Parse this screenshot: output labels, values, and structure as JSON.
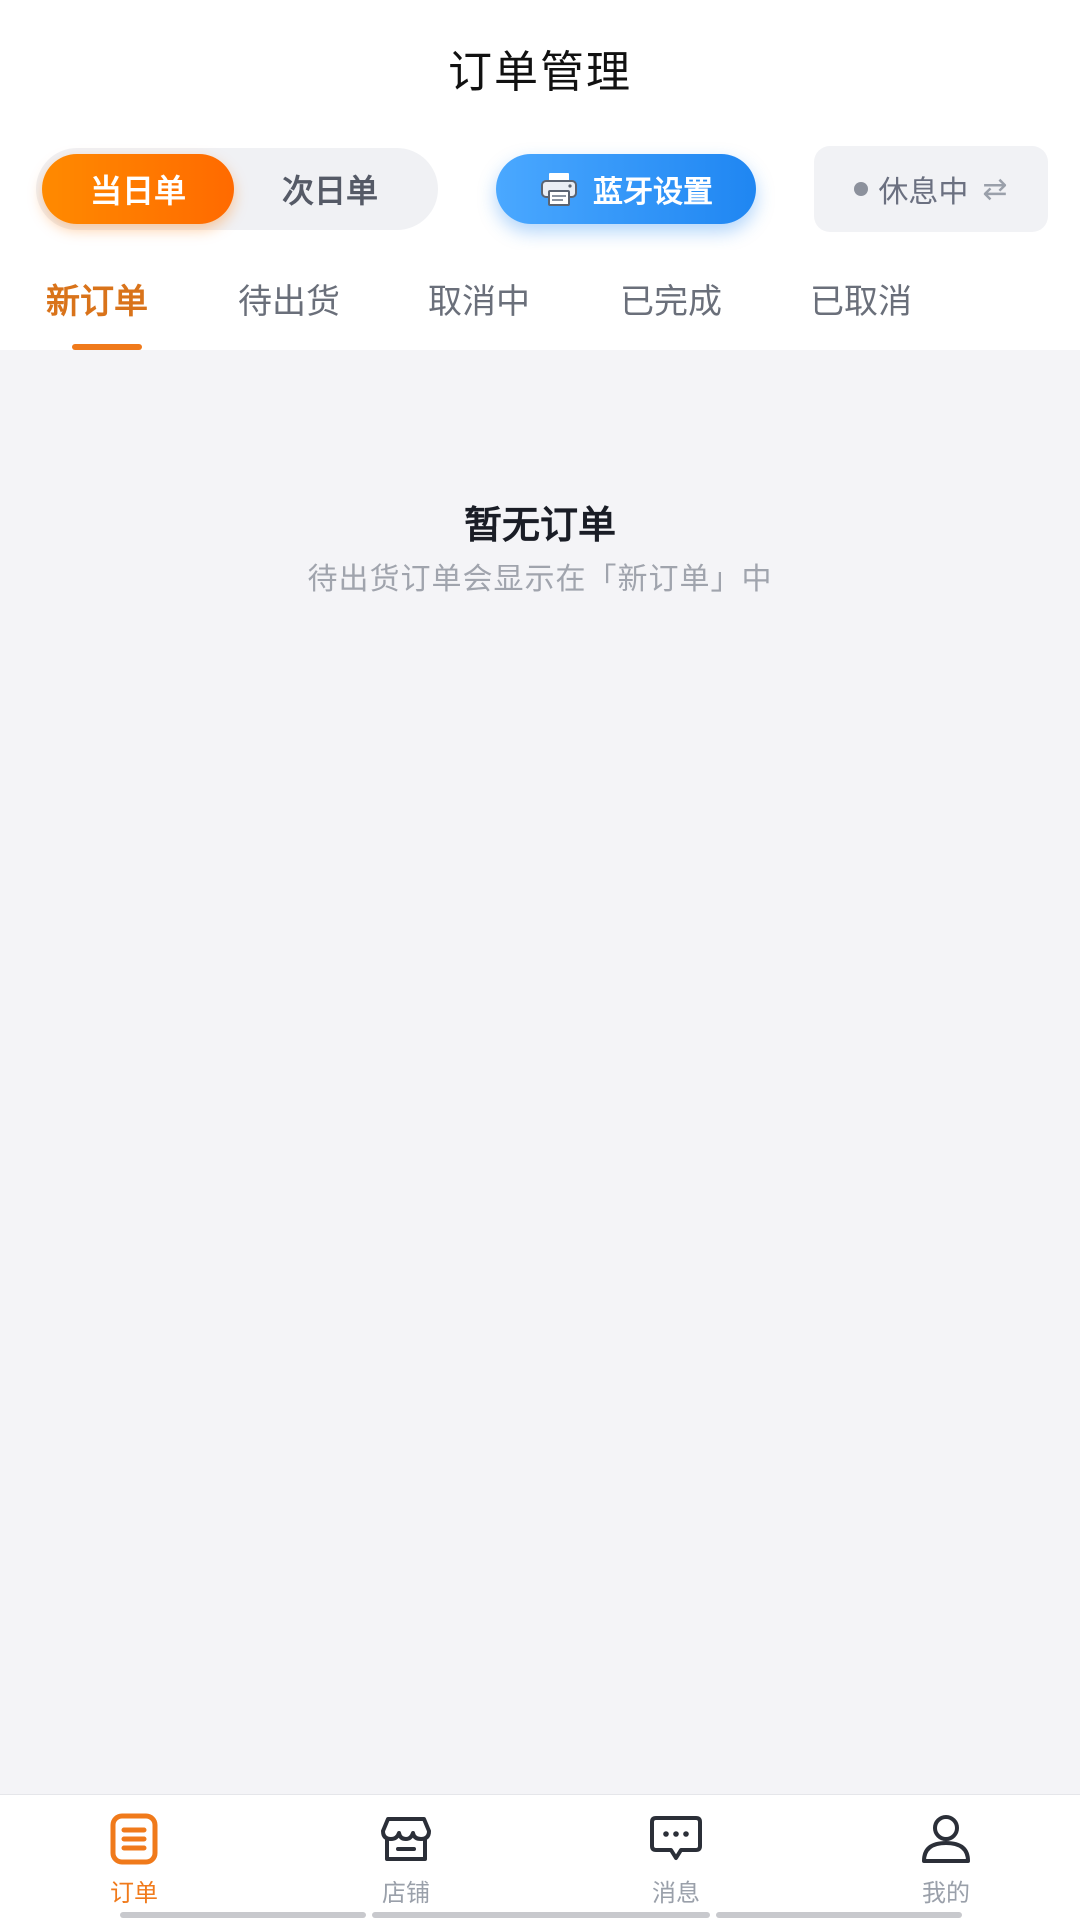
{
  "header": {
    "title": "订单管理"
  },
  "toolbar": {
    "today_label": "当日单",
    "next_day_label": "次日单",
    "bluetooth_label": "蓝牙设置",
    "status_label": "休息中",
    "swap_glyph": "⇄",
    "accent_color": "#ff7a00",
    "bluetooth_color": "#2b8ff5"
  },
  "tabs": {
    "items": [
      {
        "label": "新订单",
        "active": true
      },
      {
        "label": "待出货",
        "active": false
      },
      {
        "label": "取消中",
        "active": false
      },
      {
        "label": "已完成",
        "active": false
      },
      {
        "label": "已取消",
        "active": false
      }
    ],
    "active_color": "#d9731a"
  },
  "main": {
    "empty_title": "暂无订单",
    "empty_subtitle": "待出货订单会显示在「新订单」中"
  },
  "bottom_nav": {
    "items": [
      {
        "label": "订单",
        "icon": "order-list-icon",
        "active": true
      },
      {
        "label": "店铺",
        "icon": "store-icon",
        "active": false
      },
      {
        "label": "消息",
        "icon": "message-icon",
        "active": false
      },
      {
        "label": "我的",
        "icon": "user-icon",
        "active": false
      }
    ]
  }
}
